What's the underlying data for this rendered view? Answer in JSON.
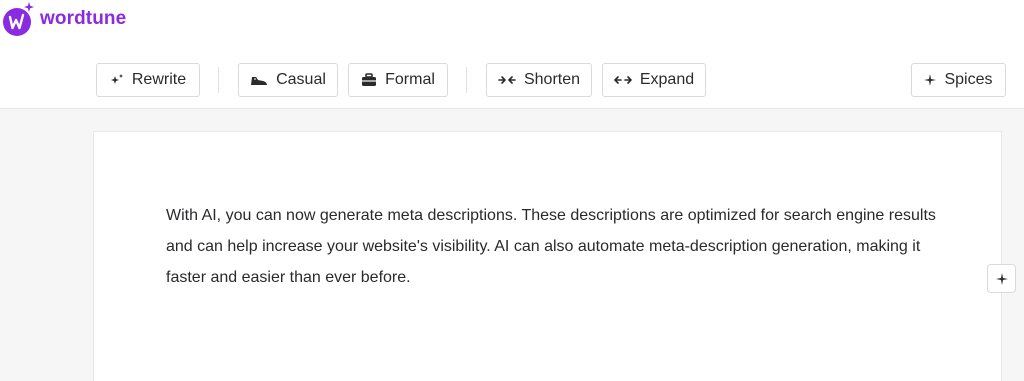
{
  "brand": {
    "name": "wordtune",
    "color": "#8a2be2",
    "logo_icon": "wordtune-logo"
  },
  "toolbar": {
    "rewrite_label": "Rewrite",
    "casual_label": "Casual",
    "formal_label": "Formal",
    "shorten_label": "Shorten",
    "expand_label": "Expand",
    "spices_label": "Spices"
  },
  "editor": {
    "text": "With AI, you can now generate meta descriptions. These descriptions are optimized for search engine results and can help increase your website's visibility. AI can also automate meta-description generation, making it faster and easier than ever before."
  },
  "icons": {
    "rewrite": "sparkle-icon",
    "casual": "sneaker-icon",
    "formal": "briefcase-icon",
    "shorten": "arrows-inward-icon",
    "expand": "arrows-outward-icon",
    "spices": "plus-star-icon",
    "floating_add": "plus-icon"
  }
}
